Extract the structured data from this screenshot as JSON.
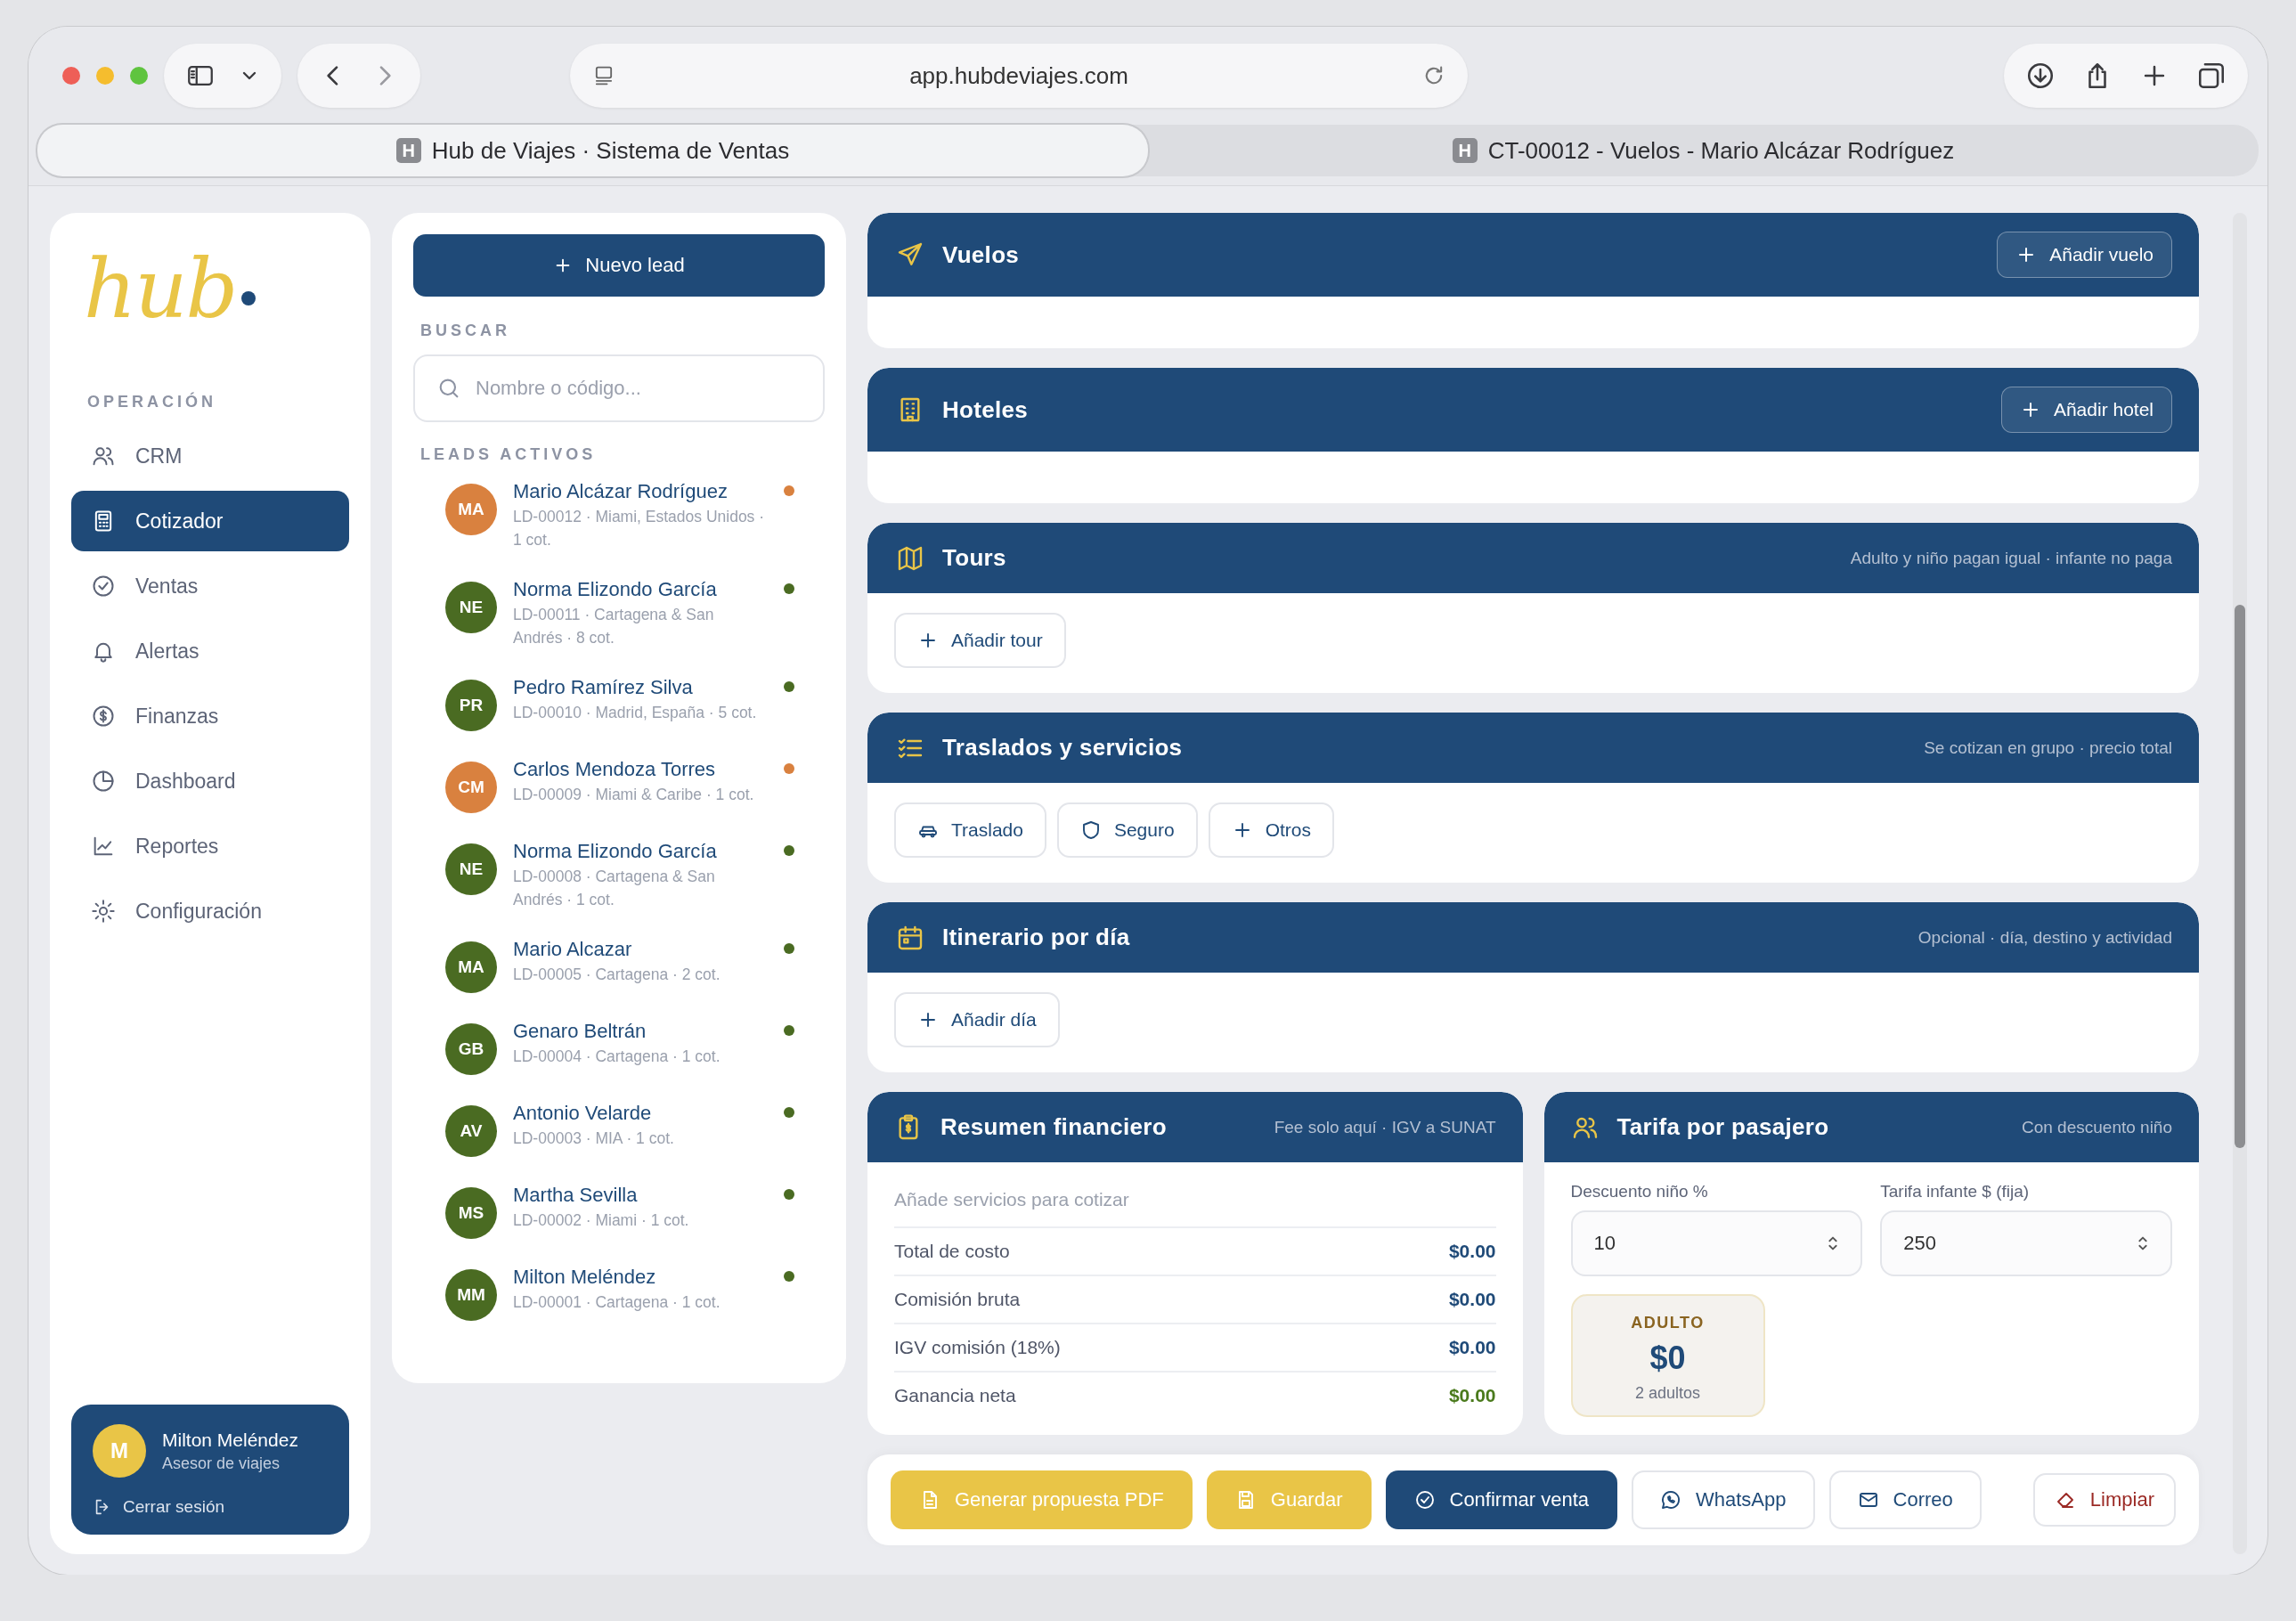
{
  "browser": {
    "url": "app.hubdeviajes.com",
    "tabs": [
      {
        "favicon": "H",
        "label": "Hub de Viajes · Sistema de Ventas",
        "selected": true
      },
      {
        "favicon": "H",
        "label": "CT-00012 - Vuelos - Mario Alcázar Rodríguez",
        "selected": false
      }
    ]
  },
  "sidebar": {
    "logo": "hub",
    "section_label": "OPERACIÓN",
    "items": [
      {
        "label": "CRM",
        "selected": false
      },
      {
        "label": "Cotizador",
        "selected": true
      },
      {
        "label": "Ventas",
        "selected": false
      },
      {
        "label": "Alertas",
        "selected": false
      },
      {
        "label": "Finanzas",
        "selected": false
      },
      {
        "label": "Dashboard",
        "selected": false
      },
      {
        "label": "Reportes",
        "selected": false
      },
      {
        "label": "Configuración",
        "selected": false
      }
    ],
    "user": {
      "initial": "M",
      "name": "Milton Meléndez",
      "role": "Asesor de viajes",
      "logout": "Cerrar sesión"
    }
  },
  "leads": {
    "new_button": "Nuevo lead",
    "search_label": "BUSCAR",
    "search": {
      "placeholder": "Nombre o código..."
    },
    "list_label": "LEADS ACTIVOS",
    "items": [
      {
        "initials": "MA",
        "name": "Mario Alcázar Rodríguez",
        "detail": "LD-00012 · Miami, Estados Unidos · 1 cot.",
        "color": "#d9813f"
      },
      {
        "initials": "NE",
        "name": "Norma Elizondo García",
        "detail": "LD-00011 · Cartagena & San Andrés · 8 cot.",
        "color": "#4a6b22"
      },
      {
        "initials": "PR",
        "name": "Pedro Ramírez Silva",
        "detail": "LD-00010 · Madrid, España · 5 cot.",
        "color": "#4a6b22"
      },
      {
        "initials": "CM",
        "name": "Carlos Mendoza Torres",
        "detail": "LD-00009 · Miami & Caribe · 1 cot.",
        "color": "#d9813f"
      },
      {
        "initials": "NE",
        "name": "Norma Elizondo García",
        "detail": "LD-00008 · Cartagena & San Andrés · 1 cot.",
        "color": "#4a6b22"
      },
      {
        "initials": "MA",
        "name": "Mario Alcazar",
        "detail": "LD-00005 · Cartagena · 2 cot.",
        "color": "#4a6b22"
      },
      {
        "initials": "GB",
        "name": "Genaro Beltrán",
        "detail": "LD-00004 · Cartagena · 1 cot.",
        "color": "#4a6b22"
      },
      {
        "initials": "AV",
        "name": "Antonio Velarde",
        "detail": "LD-00003 · MIA · 1 cot.",
        "color": "#4a6b22"
      },
      {
        "initials": "MS",
        "name": "Martha Sevilla",
        "detail": "LD-00002 · Miami · 1 cot.",
        "color": "#4a6b22"
      },
      {
        "initials": "MM",
        "name": "Milton Meléndez",
        "detail": "LD-00001 · Cartagena · 1 cot.",
        "color": "#4a6b22"
      }
    ]
  },
  "sections": [
    {
      "title": "Vuelos",
      "header_button": "Añadir vuelo"
    },
    {
      "title": "Hoteles",
      "header_button": "Añadir hotel"
    },
    {
      "title": "Tours",
      "note": "Adulto y niño pagan igual · infante no paga",
      "actions": [
        "Añadir tour"
      ]
    },
    {
      "title": "Traslados y servicios",
      "note": "Se cotizan en grupo · precio total",
      "actions": [
        "Traslado",
        "Seguro",
        "Otros"
      ]
    },
    {
      "title": "Itinerario por día",
      "note": "Opcional · día, destino y actividad",
      "actions": [
        "Añadir día"
      ]
    }
  ],
  "finance": {
    "title": "Resumen financiero",
    "note": "Fee solo aquí · IGV a SUNAT",
    "placeholder": "Añade servicios para cotizar",
    "rows": [
      {
        "label": "Total de costo",
        "value": "$0.00",
        "kind": "amount"
      },
      {
        "label": "Comisión bruta",
        "value": "$0.00",
        "kind": "amount"
      },
      {
        "label": "IGV comisión (18%)",
        "value": "$0.00",
        "kind": "amount"
      },
      {
        "label": "Ganancia neta",
        "value": "$0.00",
        "kind": "profit"
      }
    ]
  },
  "fare": {
    "title": "Tarifa por pasajero",
    "note": "Con descuento niño",
    "fields": [
      {
        "label": "Descuento niño %",
        "value": "10"
      },
      {
        "label": "Tarifa infante $ (fija)",
        "value": "250"
      }
    ],
    "cards": [
      {
        "label": "ADULTO",
        "amount": "$0",
        "detail": "2 adultos"
      }
    ]
  },
  "actions": [
    {
      "label": "Generar propuesta PDF",
      "kind": "yellow"
    },
    {
      "label": "Guardar",
      "kind": "yellow"
    },
    {
      "label": "Confirmar venta",
      "kind": "navy"
    },
    {
      "label": "WhatsApp",
      "kind": "outline"
    },
    {
      "label": "Correo",
      "kind": "outline"
    },
    {
      "label": "Limpiar",
      "kind": "danger"
    }
  ]
}
